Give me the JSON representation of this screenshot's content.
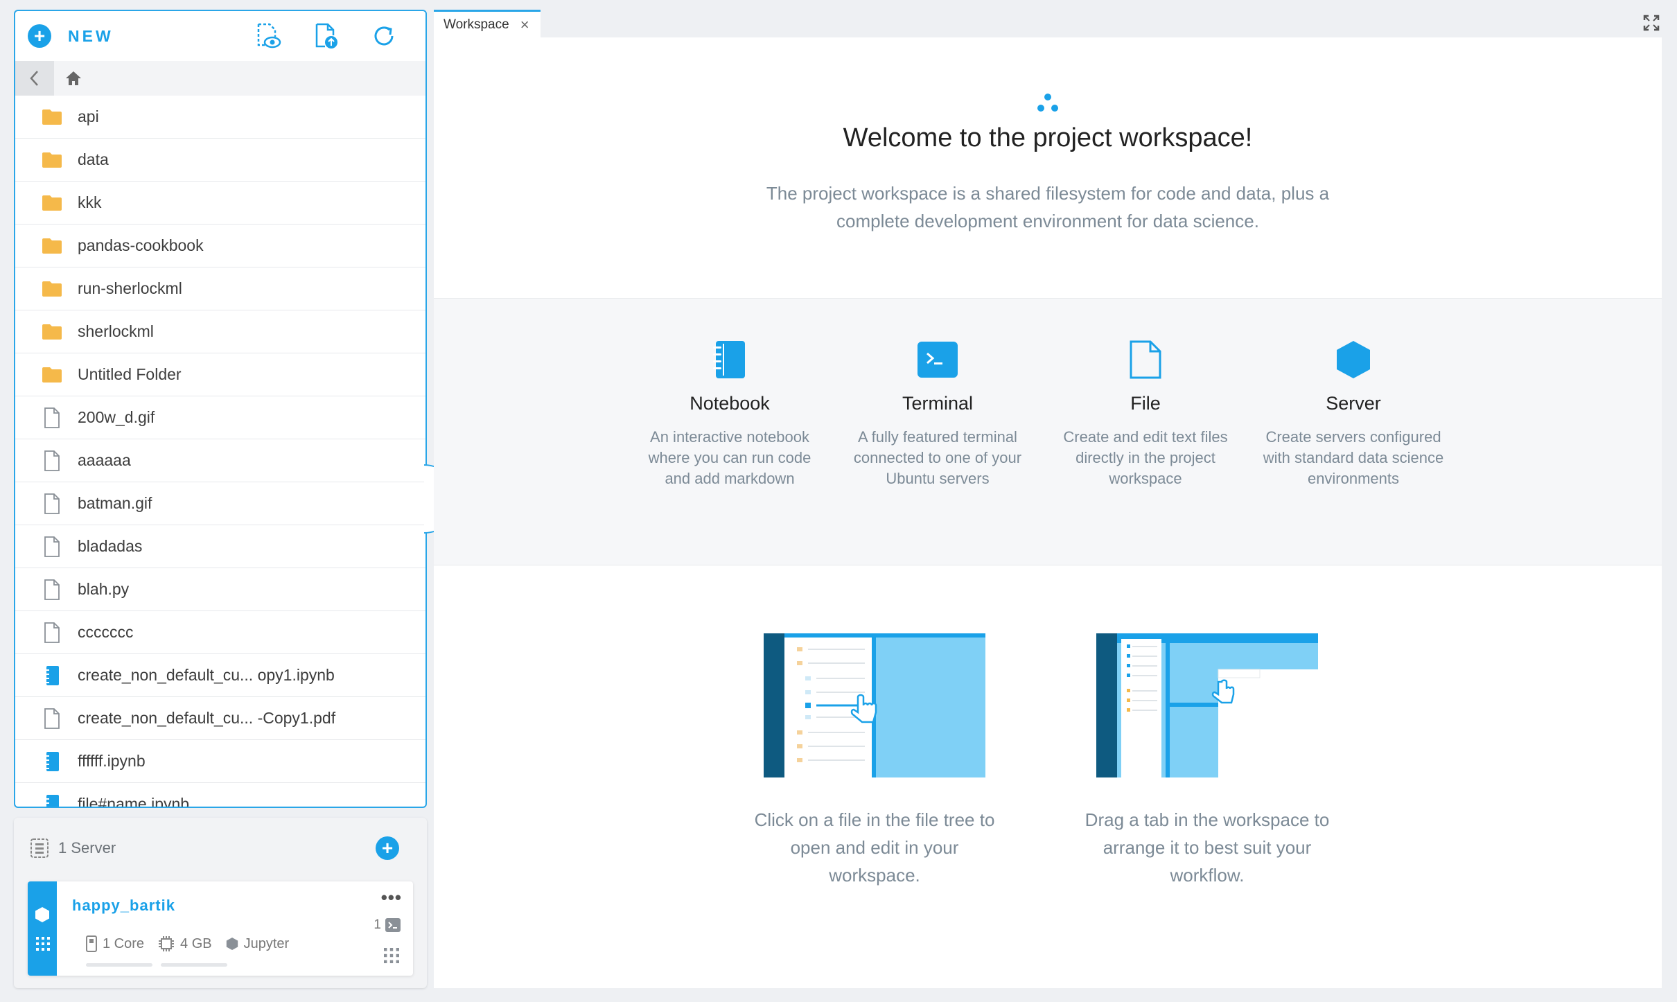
{
  "file_panel": {
    "new_label": "NEW",
    "toolbar_icons": [
      "preview-icon",
      "upload-file-icon",
      "refresh-icon"
    ],
    "files": [
      {
        "name": "api",
        "type": "folder"
      },
      {
        "name": "data",
        "type": "folder"
      },
      {
        "name": "kkk",
        "type": "folder"
      },
      {
        "name": "pandas-cookbook",
        "type": "folder"
      },
      {
        "name": "run-sherlockml",
        "type": "folder"
      },
      {
        "name": "sherlockml",
        "type": "folder"
      },
      {
        "name": "Untitled Folder",
        "type": "folder"
      },
      {
        "name": "200w_d.gif",
        "type": "file"
      },
      {
        "name": "aaaaaa",
        "type": "file"
      },
      {
        "name": "batman.gif",
        "type": "file"
      },
      {
        "name": "bladadas",
        "type": "file"
      },
      {
        "name": "blah.py",
        "type": "file"
      },
      {
        "name": "ccccccc",
        "type": "file"
      },
      {
        "name": "create_non_default_cu... opy1.ipynb",
        "type": "notebook"
      },
      {
        "name": "create_non_default_cu... -Copy1.pdf",
        "type": "file"
      },
      {
        "name": "ffffff.ipynb",
        "type": "notebook"
      },
      {
        "name": "file#name.ipynb",
        "type": "notebook"
      }
    ]
  },
  "server_panel": {
    "count_label": "1 Server",
    "server": {
      "name": "happy_bartik",
      "cores": "1 Core",
      "memory": "4 GB",
      "type": "Jupyter",
      "terminal_count": "1",
      "menu": "•••"
    }
  },
  "tabs": [
    {
      "label": "Workspace",
      "close": "×"
    }
  ],
  "workspace": {
    "title": "Welcome to the project workspace!",
    "subtitle": "The project workspace is a shared filesystem for code and data, plus a complete development environment for data science.",
    "features": [
      {
        "title": "Notebook",
        "desc": "An interactive notebook where you can run code and add markdown",
        "icon": "notebook-icon"
      },
      {
        "title": "Terminal",
        "desc": "A fully featured terminal connected to one of your Ubuntu servers",
        "icon": "terminal-icon"
      },
      {
        "title": "File",
        "desc": "Create and edit text files directly in the project workspace",
        "icon": "file-icon"
      },
      {
        "title": "Server",
        "desc": "Create servers configured with standard data science environments",
        "icon": "server-hex-icon"
      }
    ],
    "tips": [
      {
        "text": "Click on a file in the file tree to open and edit in your workspace."
      },
      {
        "text": "Drag a tab in the workspace to arrange it to best suit your workflow."
      }
    ]
  },
  "colors": {
    "accent": "#1aa1e8",
    "folder": "#f5b94a",
    "muted_text": "#7c8a96"
  }
}
